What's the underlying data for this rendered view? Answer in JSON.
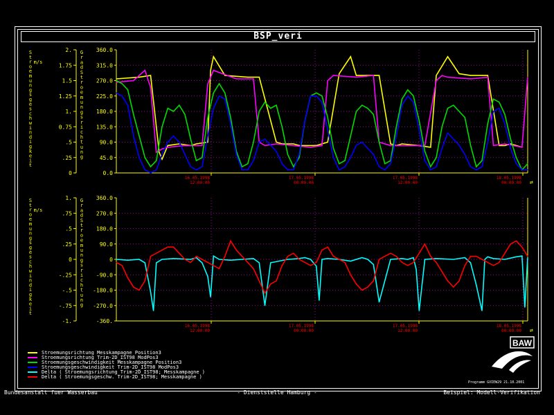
{
  "title": "BSP_veri",
  "panels": [
    {
      "left_axis_label": "Stroemungsgeschwindigkeit",
      "left_unit": "m/s",
      "right_axis_label": "Grad Stroemungsrichtung",
      "left_ticks": [
        "2.",
        "1.75",
        "1.5",
        "1.25",
        "1.",
        "0.75",
        ".5",
        ".25",
        "0"
      ],
      "right_ticks": [
        "360.0",
        "315.0",
        "270.0",
        "225.0",
        "180.0",
        "135.0",
        "90.0",
        "45.0",
        "0.0"
      ]
    },
    {
      "left_axis_label": "Stroemungsgeschwindigkeit",
      "left_unit": "m/s",
      "right_axis_label": "Grad Stroemungsrichtung",
      "left_ticks": [
        "1.",
        ".75",
        ".5",
        ".25",
        "0",
        "-.25",
        "-.5",
        "-.75",
        "-1."
      ],
      "right_ticks": [
        "360.0",
        "270.0",
        "180.0",
        "90.0",
        "0",
        "-90.0",
        "-180.0",
        "-270.0",
        "-360."
      ]
    }
  ],
  "x_ticks": [
    {
      "date": "16.05.1998",
      "time": "12:00:00"
    },
    {
      "date": "17.05.1998",
      "time": "00:00:00"
    },
    {
      "date": "17.05.1998",
      "time": "12:00:00"
    },
    {
      "date": "18.05.1998",
      "time": "00:00:00"
    }
  ],
  "legend": [
    {
      "label": "Stroemungsrichtung Messkampagne Position3",
      "color": "#ffff00"
    },
    {
      "label": "Stroemungsrichtung Trim-2D_IST98 ModPos3",
      "color": "#ff00ff"
    },
    {
      "label": "Stroemungsgeschwindigkeit Messkampagne Position3",
      "color": "#00dd00"
    },
    {
      "label": "Stroemungsgeschwindigkeit Trim-2D_IST98 ModPos3",
      "color": "#0000ff"
    },
    {
      "label": "Delta ( Stroemungsrichtung Trim-2D_IST98; Messkampagne )",
      "color": "#00ffff"
    },
    {
      "label": "Delta ( Stroemungsgeschw. Trim-2D_IST98; Messkampagne )",
      "color": "#ff0000"
    }
  ],
  "logo_text": "BAW",
  "program_info": "Programm GVIEW29 21.10.2001",
  "footer": {
    "left": "Bundesanstalt fuer Wasserbau",
    "center": "- Dienststelle Hamburg -",
    "right": "Beispiel: Modell-Verifikation"
  },
  "colors": {
    "axis_yellow": "#ffff00",
    "grid": "#cc00cc",
    "date_label": "#ff0000"
  },
  "chart_data": [
    {
      "type": "line",
      "ylabel_left": "Stroemungsgeschwindigkeit m/s",
      "ylabel_right": "Grad Stroemungsrichtung",
      "ylim_left": [
        0,
        2
      ],
      "ylim_right": [
        0,
        360
      ],
      "x_unit": "hours",
      "xlim": [
        0,
        72
      ],
      "series": [
        {
          "name": "Stroemungsrichtung Messkampagne Position3",
          "axis": "right",
          "x": [
            0,
            4,
            6,
            7.5,
            8,
            9,
            11,
            13,
            14,
            16,
            16.5,
            17,
            19,
            23,
            25,
            28,
            29,
            31,
            32,
            35,
            37,
            39,
            41,
            42,
            44,
            46,
            48,
            49,
            50,
            53,
            55,
            56,
            58,
            60,
            62,
            63,
            65,
            67,
            68,
            69,
            71
          ],
          "y": [
            275,
            280,
            285,
            60,
            40,
            80,
            85,
            80,
            85,
            90,
            300,
            340,
            285,
            280,
            280,
            90,
            85,
            85,
            80,
            80,
            90,
            290,
            340,
            285,
            285,
            285,
            85,
            80,
            85,
            80,
            75,
            285,
            340,
            290,
            285,
            285,
            285,
            80,
            80,
            85,
            75
          ]
        },
        {
          "name": "Stroemungsrichtung Trim-2D_IST98 ModPos3",
          "axis": "right",
          "x": [
            0,
            3,
            5,
            6,
            7,
            8,
            9,
            12,
            15,
            16,
            17,
            21,
            24,
            25,
            26,
            28,
            31,
            34,
            36,
            37,
            38,
            42,
            45,
            46,
            48,
            51,
            54,
            56,
            57,
            58,
            62,
            65,
            66,
            68,
            71,
            72
          ],
          "y": [
            265,
            270,
            300,
            250,
            60,
            70,
            75,
            80,
            80,
            260,
            300,
            275,
            275,
            90,
            80,
            85,
            80,
            75,
            80,
            270,
            285,
            280,
            285,
            90,
            80,
            80,
            80,
            270,
            285,
            280,
            275,
            280,
            80,
            85,
            75,
            280
          ]
        },
        {
          "name": "Stroemungsgeschwindigkeit Messkampagne Position3",
          "axis": "left",
          "x": [
            0,
            1,
            2,
            3,
            4,
            5,
            6,
            7,
            8,
            9,
            10,
            11,
            12,
            13,
            14,
            15,
            16,
            17,
            18,
            19,
            20,
            21,
            22,
            23,
            24,
            25,
            26,
            27,
            28,
            29,
            30,
            31,
            32,
            33,
            34,
            35,
            36,
            37,
            38,
            39,
            40,
            41,
            42,
            43,
            44,
            45,
            46,
            47,
            48,
            49,
            50,
            51,
            52,
            53,
            54,
            55,
            56,
            57,
            58,
            59,
            60,
            61,
            62,
            63,
            64,
            65,
            66,
            67,
            68,
            69,
            70,
            71,
            72
          ],
          "y": [
            1.5,
            1.45,
            1.35,
            0.95,
            0.6,
            0.25,
            0.1,
            0.2,
            0.75,
            1.05,
            1.0,
            1.1,
            0.95,
            0.55,
            0.2,
            0.25,
            0.9,
            1.3,
            1.45,
            1.3,
            0.9,
            0.35,
            0.1,
            0.15,
            0.5,
            1.0,
            1.15,
            1.05,
            1.1,
            0.75,
            0.3,
            0.1,
            0.25,
            0.85,
            1.25,
            1.3,
            1.25,
            0.9,
            0.4,
            0.15,
            0.2,
            0.6,
            1.0,
            1.1,
            1.05,
            0.95,
            0.5,
            0.15,
            0.2,
            0.75,
            1.2,
            1.35,
            1.25,
            0.85,
            0.35,
            0.1,
            0.25,
            0.75,
            1.05,
            1.1,
            1.0,
            0.9,
            0.45,
            0.1,
            0.2,
            0.8,
            1.2,
            1.15,
            0.95,
            0.55,
            0.25,
            0.05,
            0.15
          ]
        },
        {
          "name": "Stroemungsgeschwindigkeit Trim-2D_IST98 ModPos3",
          "axis": "left",
          "x": [
            0,
            1,
            2,
            3,
            4,
            5,
            6,
            7,
            8,
            9,
            10,
            11,
            12,
            13,
            14,
            15,
            16,
            17,
            18,
            19,
            20,
            21,
            22,
            23,
            24,
            25,
            26,
            27,
            28,
            29,
            30,
            31,
            32,
            33,
            34,
            35,
            36,
            37,
            38,
            39,
            40,
            41,
            42,
            43,
            44,
            45,
            46,
            47,
            48,
            49,
            50,
            51,
            52,
            53,
            54,
            55,
            56,
            57,
            58,
            59,
            60,
            61,
            62,
            63,
            64,
            65,
            66,
            67,
            68,
            69,
            70,
            71,
            72
          ],
          "y": [
            1.3,
            1.25,
            1.1,
            0.6,
            0.25,
            0.05,
            0.0,
            0.05,
            0.3,
            0.5,
            0.6,
            0.5,
            0.3,
            0.1,
            0.05,
            0.1,
            0.6,
            1.05,
            1.25,
            1.2,
            0.8,
            0.3,
            0.05,
            0.05,
            0.2,
            0.5,
            0.55,
            0.45,
            0.35,
            0.15,
            0.05,
            0.05,
            0.3,
            0.85,
            1.25,
            1.25,
            1.15,
            0.7,
            0.25,
            0.05,
            0.1,
            0.25,
            0.45,
            0.5,
            0.4,
            0.3,
            0.1,
            0.05,
            0.15,
            0.6,
            1.1,
            1.25,
            1.15,
            0.7,
            0.2,
            0.05,
            0.1,
            0.4,
            0.65,
            0.55,
            0.45,
            0.3,
            0.1,
            0.05,
            0.1,
            0.5,
            1.0,
            1.05,
            0.8,
            0.4,
            0.15,
            0.05,
            0.05
          ]
        }
      ]
    },
    {
      "type": "line",
      "ylabel_left": "Stroemungsgeschwindigkeit m/s",
      "ylabel_right": "Grad Stroemungsrichtung",
      "ylim_left": [
        -1,
        1
      ],
      "ylim_right": [
        -360,
        360
      ],
      "x_unit": "hours",
      "xlim": [
        0,
        72
      ],
      "series": [
        {
          "name": "Delta ( Stroemungsrichtung Trim-2D_IST98; Messkampagne )",
          "axis": "right",
          "x": [
            0,
            2,
            4,
            5,
            6,
            6.5,
            7,
            8,
            10,
            13,
            14,
            15,
            16,
            16.5,
            17,
            18,
            20,
            22,
            24,
            25,
            26,
            27,
            30,
            32,
            33,
            34,
            35,
            35.5,
            36,
            37,
            39,
            41,
            43,
            44,
            45,
            46,
            48,
            50,
            51,
            52,
            52.5,
            53,
            54,
            56,
            59,
            61,
            62,
            63,
            64,
            64.5,
            65,
            66,
            68,
            70,
            71,
            71.5,
            72
          ],
          "y": [
            0,
            -5,
            0,
            -20,
            -190,
            -300,
            -20,
            0,
            5,
            0,
            10,
            -20,
            -100,
            -220,
            20,
            0,
            -5,
            0,
            5,
            -20,
            -270,
            -20,
            0,
            5,
            10,
            0,
            -40,
            -240,
            0,
            5,
            0,
            -10,
            10,
            0,
            -30,
            -250,
            0,
            5,
            0,
            10,
            -60,
            -300,
            0,
            5,
            0,
            10,
            -20,
            -150,
            -300,
            0,
            15,
            5,
            0,
            15,
            20,
            -280,
            10
          ]
        },
        {
          "name": "Delta ( Stroemungsgeschw. Trim-2D_IST98; Messkampagne )",
          "axis": "left",
          "x": [
            0,
            1,
            2,
            3,
            4,
            5,
            6,
            7,
            8,
            9,
            10,
            11,
            12,
            13,
            14,
            15,
            16,
            17,
            18,
            19,
            20,
            21,
            22,
            23,
            24,
            25,
            26,
            27,
            28,
            29,
            30,
            31,
            32,
            33,
            34,
            35,
            36,
            37,
            38,
            39,
            40,
            41,
            42,
            43,
            44,
            45,
            46,
            47,
            48,
            49,
            50,
            51,
            52,
            53,
            54,
            55,
            56,
            57,
            58,
            59,
            60,
            61,
            62,
            63,
            64,
            65,
            66,
            67,
            68,
            69,
            70,
            71,
            72
          ],
          "y": [
            -0.05,
            -0.1,
            -0.3,
            -0.45,
            -0.5,
            -0.35,
            0.05,
            0.1,
            0.15,
            0.2,
            0.2,
            0.1,
            0.0,
            -0.05,
            0.05,
            0.0,
            -0.05,
            -0.1,
            -0.15,
            0.05,
            0.3,
            0.15,
            0.05,
            -0.05,
            -0.15,
            -0.35,
            -0.55,
            -0.4,
            -0.35,
            -0.1,
            0.05,
            0.1,
            0.0,
            -0.05,
            -0.1,
            -0.05,
            0.15,
            0.2,
            0.05,
            0.0,
            -0.05,
            -0.25,
            -0.4,
            -0.5,
            -0.45,
            -0.35,
            0.0,
            0.05,
            0.1,
            0.05,
            -0.05,
            -0.1,
            -0.05,
            0.1,
            0.25,
            0.05,
            -0.05,
            -0.2,
            -0.35,
            -0.45,
            -0.35,
            -0.1,
            0.05,
            0.05,
            0.0,
            -0.05,
            -0.1,
            -0.05,
            0.1,
            0.25,
            0.3,
            0.2,
            0.05
          ]
        }
      ]
    }
  ]
}
